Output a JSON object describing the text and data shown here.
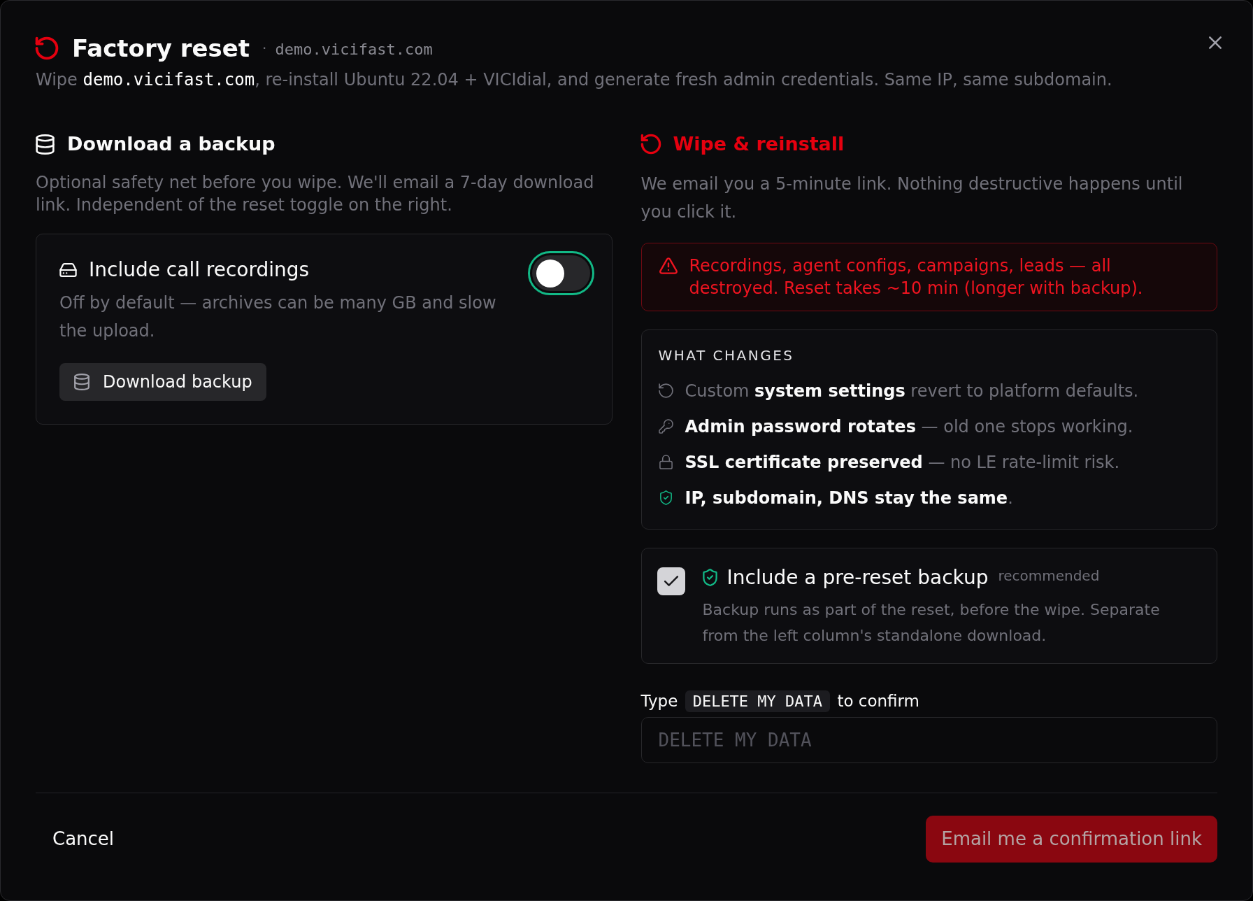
{
  "header": {
    "title": "Factory reset",
    "separator": "·",
    "domain": "demo.vicifast.com",
    "subtitle": [
      {
        "kind": "text",
        "text": "Wipe "
      },
      {
        "kind": "code",
        "text": "demo.vicifast.com"
      },
      {
        "kind": "text",
        "text": ", re-install Ubuntu 22.04 + VICIdial, and generate fresh admin credentials. Same IP, same subdomain."
      }
    ]
  },
  "backup_section": {
    "title": "Download a backup",
    "description": "Optional safety net before you wipe. We'll email a 7-day download link. Independent of the reset toggle on the right.",
    "recordings_option": {
      "label": "Include call recordings",
      "description": "Off by default — archives can be many GB and slow the upload.",
      "on": false
    },
    "download_button": "Download backup"
  },
  "reset_section": {
    "title": "Wipe & reinstall",
    "description": "We email you a 5-minute link. Nothing destructive happens until you click it.",
    "warning": "Recordings, agent configs, campaigns, leads — all destroyed. Reset takes ~10 min (longer with backup).",
    "what_changes": {
      "heading": "WHAT CHANGES",
      "items": [
        {
          "kind": "reset",
          "text": "Custom **system settings** revert to platform defaults."
        },
        {
          "kind": "key",
          "text": "**Admin password rotates** — old one stops working."
        },
        {
          "kind": "lock",
          "text": "**SSL certificate preserved** — no LE rate-limit risk."
        },
        {
          "kind": "shield",
          "text": "**IP, subdomain, DNS stay the same**."
        }
      ]
    },
    "backup_option": {
      "label": "Include a pre-reset backup",
      "note": "recommended",
      "description": "Backup runs as part of the reset, before the wipe. Separate from the left column's standalone download.",
      "checked": true
    },
    "confirm": {
      "label_before": "Type",
      "phrase": "DELETE MY DATA",
      "label_after": "to confirm",
      "placeholder": "DELETE MY DATA"
    }
  },
  "footer": {
    "cancel": "Cancel",
    "submit": {
      "label": "Email me a confirmation link",
      "disabled": true
    }
  }
}
